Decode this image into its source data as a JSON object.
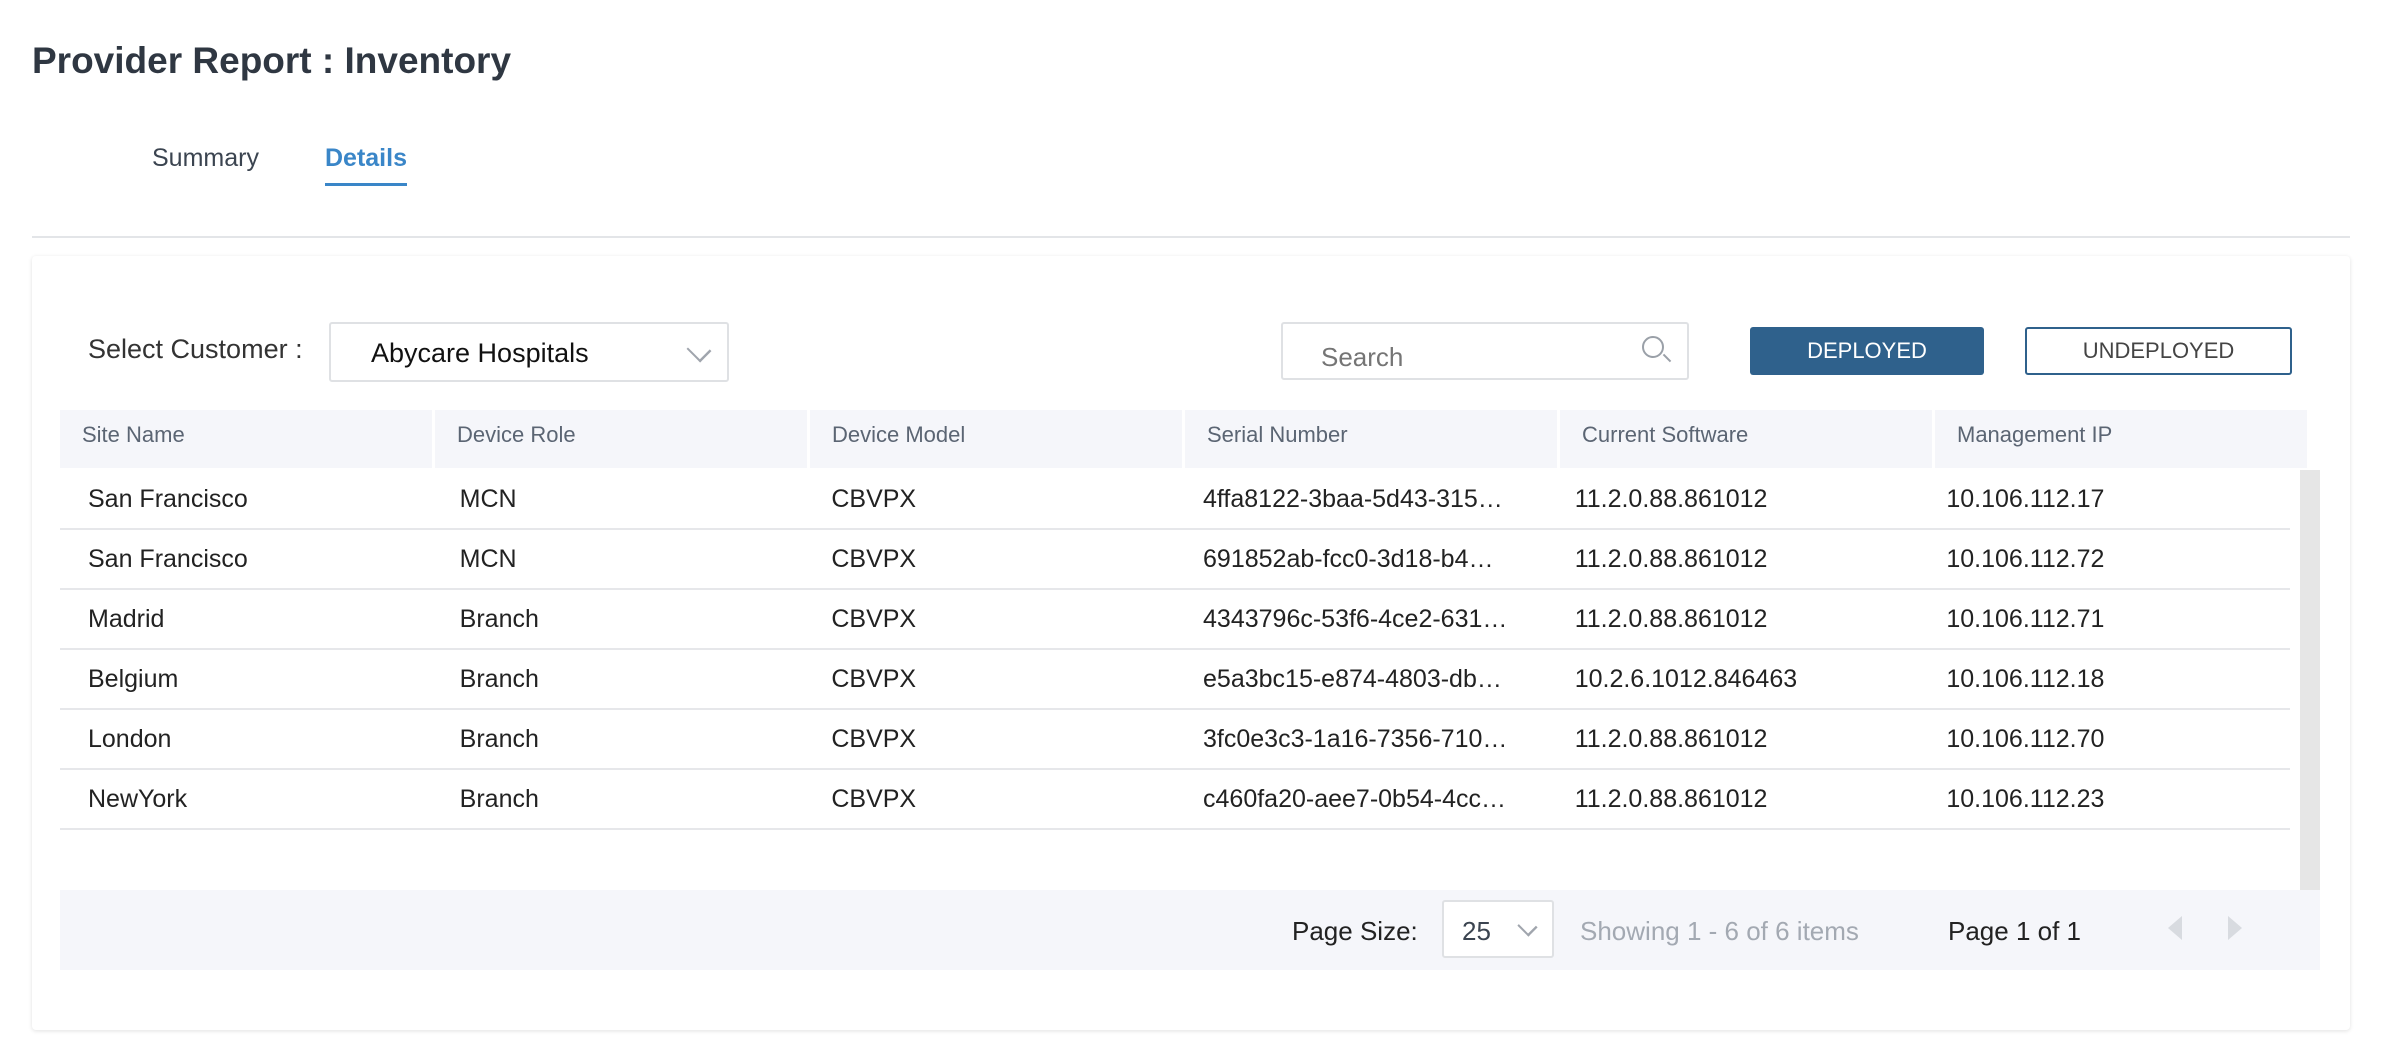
{
  "header": {
    "title": "Provider Report : Inventory"
  },
  "tabs": [
    {
      "label": "Summary",
      "active": false
    },
    {
      "label": "Details",
      "active": true
    }
  ],
  "filters": {
    "customer_label": "Select Customer :",
    "customer_value": "Abycare Hospitals",
    "search_placeholder": "Search",
    "deployed_label": "DEPLOYED",
    "undeployed_label": "UNDEPLOYED"
  },
  "table": {
    "columns": [
      "Site Name",
      "Device Role",
      "Device Model",
      "Serial Number",
      "Current Software",
      "Management IP"
    ],
    "rows": [
      [
        "San Francisco",
        "MCN",
        "CBVPX",
        "4ffa8122-3baa-5d43-315…",
        "11.2.0.88.861012",
        "10.106.112.17"
      ],
      [
        "San Francisco",
        "MCN",
        "CBVPX",
        "691852ab-fcc0-3d18-b4…",
        "11.2.0.88.861012",
        "10.106.112.72"
      ],
      [
        "Madrid",
        "Branch",
        "CBVPX",
        "4343796c-53f6-4ce2-631…",
        "11.2.0.88.861012",
        "10.106.112.71"
      ],
      [
        "Belgium",
        "Branch",
        "CBVPX",
        "e5a3bc15-e874-4803-db…",
        "10.2.6.1012.846463",
        "10.106.112.18"
      ],
      [
        "London",
        "Branch",
        "CBVPX",
        "3fc0e3c3-1a16-7356-710…",
        "11.2.0.88.861012",
        "10.106.112.70"
      ],
      [
        "NewYork",
        "Branch",
        "CBVPX",
        "c460fa20-aee7-0b54-4cc…",
        "11.2.0.88.861012",
        "10.106.112.23"
      ]
    ]
  },
  "pagination": {
    "page_size_label": "Page Size:",
    "page_size": "25",
    "showing": "Showing 1 - 6 of 6 items",
    "page": "Page 1 of 1"
  },
  "colors": {
    "accent": "#3a86c8",
    "primary_button": "#2f618c"
  }
}
